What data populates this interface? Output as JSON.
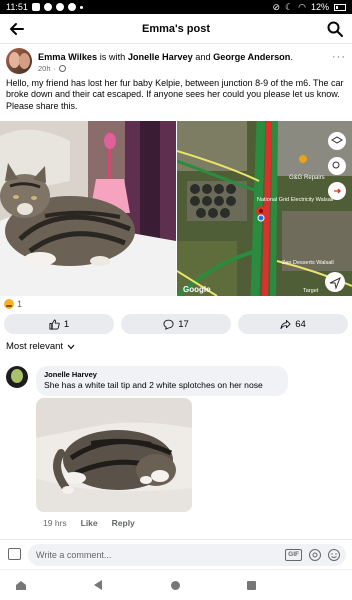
{
  "status_bar": {
    "time": "11:51",
    "battery": "12%"
  },
  "header": {
    "title": "Emma's post",
    "back_icon": "arrow-left-icon",
    "search_icon": "search-icon"
  },
  "post": {
    "author": "Emma Wilkes",
    "is_with_text": "is with",
    "tag1": "Jonelle Harvey",
    "and_text": "and",
    "tag2": "George Anderson",
    "period": ".",
    "time": "20h",
    "more": "···",
    "text": "Hello, my friend has lost her fur baby Kelpie, between junction 8-9 of the m6. The car broke down and their cat escaped. If anyone sees her could you please let us know. Please share this.",
    "map": {
      "label_gg": "G&G Repairs",
      "label_grid": "National Grid Electricity Walsall",
      "label_zen": "Zen Desserts Walsall",
      "label_google": "Google",
      "label_target": "Target"
    }
  },
  "reactions": {
    "count": "1"
  },
  "actions": [
    {
      "label": "1",
      "icon": "like-icon"
    },
    {
      "label": "17",
      "icon": "comment-icon"
    },
    {
      "label": "64",
      "icon": "share-icon"
    }
  ],
  "sort": {
    "label": "Most relevant"
  },
  "comment": {
    "author": "Jonelle Harvey",
    "text": "She has a white tail tip and 2 white splotches on her nose",
    "time": "19 hrs",
    "like": "Like",
    "reply": "Reply"
  },
  "composer": {
    "placeholder": "Write a comment...",
    "gif": "GIF"
  },
  "colors": {
    "accent": "#1877f2",
    "bubble": "#f0f2f5",
    "map_road": "#d9322a"
  }
}
